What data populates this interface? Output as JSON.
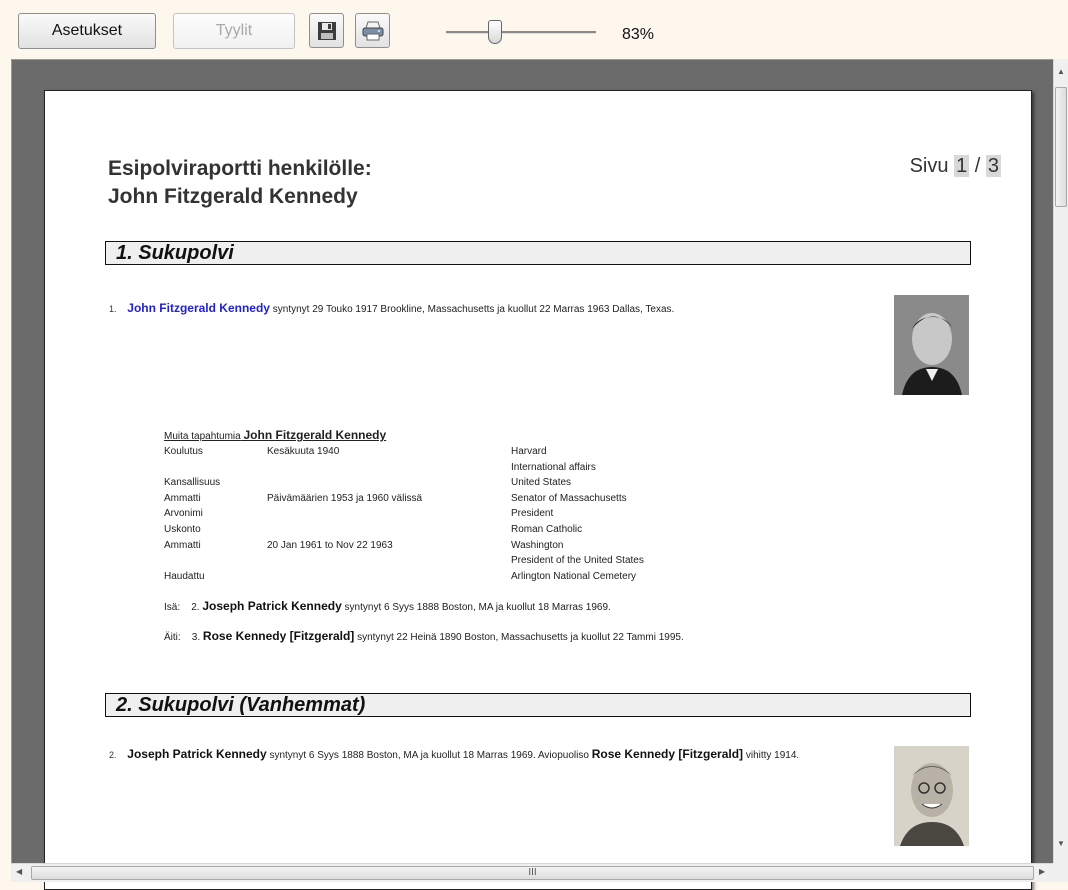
{
  "toolbar": {
    "settings_label": "Asetukset",
    "styles_label": "Tyylit",
    "zoom": "83%",
    "zoom_value": 83,
    "save_icon": "save-icon",
    "print_icon": "print-icon"
  },
  "report": {
    "title_line1": "Esipolviraportti henkilölle:",
    "title_line2": "John Fitzgerald Kennedy",
    "page_prefix": "Sivu",
    "page_current": "1",
    "page_sep": "/",
    "page_total": "3",
    "sections": [
      {
        "title": "1. Sukupolvi"
      },
      {
        "title": "2. Sukupolvi (Vanhemmat)"
      }
    ],
    "person1": {
      "num": "1.",
      "name": "John Fitzgerald Kennedy",
      "text": "syntynyt 29 Touko 1917 Brookline, Massachusetts ja kuollut 22 Marras 1963 Dallas, Texas."
    },
    "events": {
      "title_prefix": "Muita tapahtumia",
      "title_name": "John Fitzgerald Kennedy",
      "rows": [
        {
          "label": "Koulutus",
          "date": "Kesäkuuta 1940",
          "value": "Harvard"
        },
        {
          "label": "",
          "date": "",
          "value": "International affairs"
        },
        {
          "label": "Kansallisuus",
          "date": "",
          "value": "United States"
        },
        {
          "label": "Ammatti",
          "date": "Päivämäärien 1953 ja 1960 välissä",
          "value": "Senator of Massachusetts"
        },
        {
          "label": "Arvonimi",
          "date": "",
          "value": "President"
        },
        {
          "label": "Uskonto",
          "date": "",
          "value": "Roman Catholic"
        },
        {
          "label": "Ammatti",
          "date": "20 Jan 1961 to Nov 22 1963",
          "value": "Washington"
        },
        {
          "label": "",
          "date": "",
          "value": "President of the United States"
        },
        {
          "label": "Haudattu",
          "date": "",
          "value": "Arlington National Cemetery"
        }
      ]
    },
    "father": {
      "label": "Isä:",
      "num": "2.",
      "name": "Joseph Patrick Kennedy",
      "text": "syntynyt 6 Syys 1888 Boston, MA ja kuollut 18 Marras 1969."
    },
    "mother": {
      "label": "Äiti:",
      "num": "3.",
      "name": "Rose Kennedy [Fitzgerald]",
      "text": "syntynyt 22 Heinä 1890 Boston, Massachusetts ja kuollut 22 Tammi 1995."
    },
    "person2": {
      "num": "2.",
      "name": "Joseph Patrick Kennedy",
      "text": "syntynyt 6 Syys 1888 Boston, MA ja kuollut 18 Marras 1969.  Aviopuoliso",
      "spouse": "Rose Kennedy [Fitzgerald]",
      "married": "vihitty 1914."
    }
  },
  "scrollbar": {
    "grip": "III"
  }
}
